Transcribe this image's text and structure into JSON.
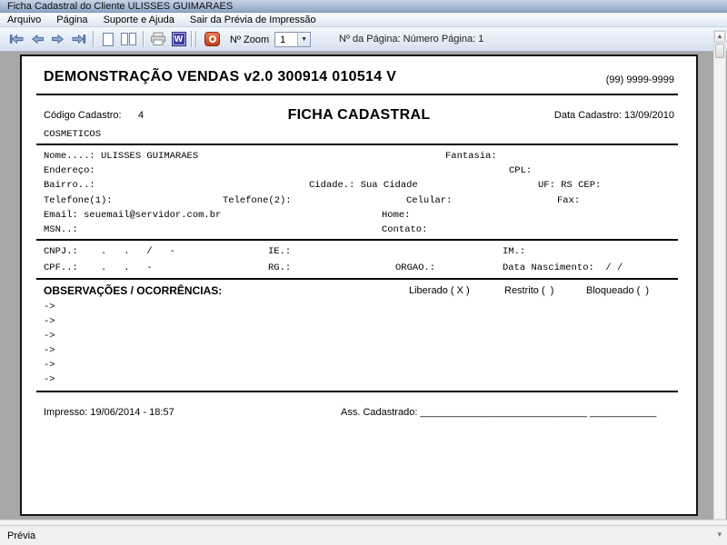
{
  "window": {
    "title": "Ficha Cadastral do Cliente ULISSES GUIMARAES"
  },
  "menubar": {
    "items": [
      {
        "label": "Arquivo"
      },
      {
        "label": "Página"
      },
      {
        "label": "Suporte e Ajuda"
      },
      {
        "label": "Sair da Prévia de Impressão"
      }
    ]
  },
  "toolbar": {
    "icon_names": [
      "first-page",
      "previous-page",
      "next-page",
      "last-page",
      "single-page-view",
      "two-page-view",
      "print",
      "export-word",
      "exit-preview"
    ],
    "word_icon_letter": "W",
    "zoom_label": "Nº Zoom",
    "zoom_value": "1",
    "dropdown_arrow": "▼",
    "page_info": "Nº da Página: Número Página: 1",
    "scroll_up_glyph": "▲",
    "status_grip_glyph": "▾"
  },
  "doc": {
    "header_title": "DEMONSTRAÇÃO VENDAS v2.0 300914 010514 V",
    "header_phone": "(99) 9999-9999",
    "codigo_label": "Código Cadastro:",
    "codigo_value": "4",
    "form_title": "FICHA CADASTRAL",
    "data_cadastro": "Data Cadastro: 13/09/2010",
    "categoria": "COSMETICOS",
    "nome": "Nome....: ULISSES GUIMARAES",
    "fantasia": "Fantasia:",
    "endereco": "Endereço:",
    "cpl": "CPL:",
    "bairro": "Bairro..:",
    "cidade": "Cidade.: Sua Cidade",
    "uf_cep": "UF: RS CEP:",
    "telefone1": "Telefone(1):",
    "telefone2": "Telefone(2):",
    "celular": "Celular:",
    "fax": "Fax:",
    "email": "Email: seuemail@servidor.com.br",
    "home": "Home:",
    "msn": "MSN..:",
    "contato": "Contato:",
    "cnpj": "CNPJ.:    .   .   /   -",
    "ie": "IE.:",
    "im": "IM.:",
    "cpf": "CPF..:    .   .   -",
    "rg": "RG.:",
    "orgao": "ORGAO.:",
    "nascimento": "Data Nascimento:  / /",
    "obs_title": "OBSERVAÇÕES / OCORRÊNCIAS:",
    "liberado": "Liberado ( X )",
    "restrito": "Restrito (  )",
    "bloqueado": "Bloqueado (  )",
    "arrow": "->",
    "impresso": "Impresso: 19/06/2014 - 18:57",
    "assinatura": "Ass. Cadastrado: ______________________________ ____________"
  },
  "statusbar": {
    "text": "Prévia"
  }
}
